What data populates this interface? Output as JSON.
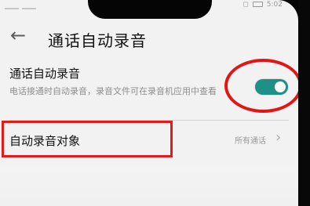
{
  "header": {
    "title": "通话自动录音",
    "back_icon": "arrow-left-icon"
  },
  "status_bar": {
    "time": "5:02"
  },
  "auto_record": {
    "title": "通话自动录音",
    "description": "电话接通时自动录音，录音文件可在录音机应用中查看",
    "enabled": true,
    "accent": "#1f9087"
  },
  "record_target": {
    "label": "自动录音对象",
    "value": "所有通话"
  },
  "annotations": {
    "highlight_color": "#e31b1b"
  }
}
